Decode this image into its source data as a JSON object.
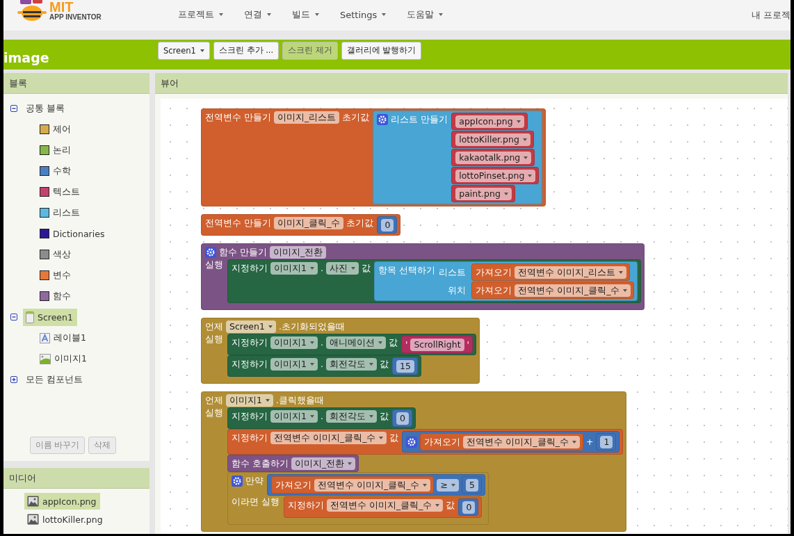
{
  "logo": {
    "title": "MIT",
    "subtitle": "APP INVENTOR"
  },
  "menu": [
    {
      "label": "프로젝트"
    },
    {
      "label": "연결"
    },
    {
      "label": "빌드"
    },
    {
      "label": "Settings"
    },
    {
      "label": "도움말"
    }
  ],
  "menu_right": "내 프로젝",
  "project": {
    "title": "image",
    "buttons": [
      {
        "label": "Screen1",
        "kind": "dropdown",
        "disabled": false
      },
      {
        "label": "스크린 추가 ...",
        "kind": "button",
        "disabled": false
      },
      {
        "label": "스크린 제거",
        "kind": "button",
        "disabled": true
      },
      {
        "label": "갤러리에 발행하기",
        "kind": "button",
        "disabled": false
      }
    ]
  },
  "blocks_panel": {
    "title": "블록",
    "tree": [
      {
        "label": "공통 블록",
        "kind": "group",
        "expanded": true,
        "selected": false,
        "children": [
          {
            "label": "제어",
            "kind": "category",
            "color": "#d6ab4a",
            "selected": false
          },
          {
            "label": "논리",
            "kind": "category",
            "color": "#86b64c",
            "selected": false
          },
          {
            "label": "수학",
            "kind": "category",
            "color": "#4a80c2",
            "selected": false
          },
          {
            "label": "텍스트",
            "kind": "category",
            "color": "#c4426f",
            "selected": false
          },
          {
            "label": "리스트",
            "kind": "category",
            "color": "#5cb8e0",
            "selected": false
          },
          {
            "label": "Dictionaries",
            "kind": "category",
            "color": "#2d1898",
            "selected": false
          },
          {
            "label": "색상",
            "kind": "category",
            "color": "#8c8c8c",
            "selected": false
          },
          {
            "label": "변수",
            "kind": "category",
            "color": "#e5783a",
            "selected": false
          },
          {
            "label": "함수",
            "kind": "category",
            "color": "#8f6a9f",
            "selected": false
          }
        ]
      },
      {
        "label": "Screen1",
        "kind": "screen",
        "expanded": true,
        "selected": true,
        "children": [
          {
            "label": "레이블1",
            "kind": "label",
            "selected": false
          },
          {
            "label": "이미지1",
            "kind": "image",
            "selected": false
          }
        ]
      },
      {
        "label": "모든 컴포넌트",
        "kind": "group",
        "expanded": false,
        "selected": false
      }
    ],
    "buttons": [
      {
        "label": "이름 바꾸기",
        "disabled": true
      },
      {
        "label": "삭제",
        "disabled": true
      }
    ]
  },
  "media_panel": {
    "title": "미디어",
    "items": [
      {
        "label": "appIcon.png",
        "selected": true
      },
      {
        "label": "lottoKiller.png",
        "selected": false
      }
    ]
  },
  "viewer": {
    "title": "뷰어",
    "stacks": [
      {
        "color": "#d05f2d",
        "head": [
          {
            "kind": "text",
            "text": "전역변수 만들기"
          },
          {
            "kind": "field",
            "text": "이미지_리스트"
          },
          {
            "kind": "text",
            "text": "초기값"
          }
        ],
        "inputs": [
          {
            "block": {
              "color": "#49a5d3",
              "head": [
                {
                  "kind": "gear"
                },
                {
                  "kind": "text",
                  "text": "리스트 만들기"
                }
              ],
              "inputs": [
                {
                  "block": {
                    "color": "#c13b44",
                    "head": [
                      {
                        "kind": "dropdown",
                        "text": "appIcon.png"
                      }
                    ]
                  }
                },
                {
                  "block": {
                    "color": "#c13b44",
                    "head": [
                      {
                        "kind": "dropdown",
                        "text": "lottoKiller.png"
                      }
                    ]
                  }
                },
                {
                  "block": {
                    "color": "#c13b44",
                    "head": [
                      {
                        "kind": "dropdown",
                        "text": "kakaotalk.png"
                      }
                    ]
                  }
                },
                {
                  "block": {
                    "color": "#c13b44",
                    "head": [
                      {
                        "kind": "dropdown",
                        "text": "lottoPinset.png"
                      }
                    ]
                  }
                },
                {
                  "block": {
                    "color": "#c13b44",
                    "head": [
                      {
                        "kind": "dropdown",
                        "text": "paint.png"
                      }
                    ]
                  }
                }
              ]
            }
          }
        ]
      },
      {
        "color": "#d05f2d",
        "head": [
          {
            "kind": "text",
            "text": "전역변수 만들기"
          },
          {
            "kind": "field",
            "text": "이미지_클릭_수"
          },
          {
            "kind": "text",
            "text": "초기값"
          }
        ],
        "inputs": [
          {
            "block": {
              "color": "#3f71b5",
              "head": [
                {
                  "kind": "field",
                  "text": "0"
                }
              ]
            }
          }
        ]
      },
      {
        "color": "#7c5385",
        "head": [
          {
            "kind": "gear"
          },
          {
            "kind": "text",
            "text": "함수 만들기"
          },
          {
            "kind": "field",
            "text": "이미지_전환"
          }
        ],
        "statements": [
          {
            "label": "실행",
            "blocks": [
              {
                "color": "#266643",
                "head": [
                  {
                    "kind": "text",
                    "text": "지정하기"
                  },
                  {
                    "kind": "dropdown",
                    "text": "이미지1"
                  },
                  {
                    "kind": "text",
                    "text": "."
                  },
                  {
                    "kind": "dropdown",
                    "text": "사진"
                  },
                  {
                    "kind": "text",
                    "text": "값"
                  }
                ],
                "inputs": [
                  {
                    "block": {
                      "color": "#49a5d3",
                      "head": [
                        {
                          "kind": "text",
                          "text": "항목 선택하기"
                        }
                      ],
                      "inputs": [
                        {
                          "label": "리스트",
                          "block": {
                            "color": "#d05f2d",
                            "head": [
                              {
                                "kind": "text",
                                "text": "가져오기"
                              },
                              {
                                "kind": "dropdown",
                                "text": "전역변수 이미지_리스트"
                              }
                            ]
                          }
                        },
                        {
                          "label": "위치",
                          "block": {
                            "color": "#d05f2d",
                            "head": [
                              {
                                "kind": "text",
                                "text": "가져오기"
                              },
                              {
                                "kind": "dropdown",
                                "text": "전역변수 이미지_클릭_수"
                              }
                            ]
                          }
                        }
                      ]
                    }
                  }
                ]
              }
            ]
          }
        ]
      },
      {
        "color": "#b18e35",
        "head": [
          {
            "kind": "text",
            "text": "언제"
          },
          {
            "kind": "dropdown",
            "text": "Screen1"
          },
          {
            "kind": "text",
            "text": ".초기화되었을때"
          }
        ],
        "statements": [
          {
            "label": "실행",
            "blocks": [
              {
                "color": "#266643",
                "head": [
                  {
                    "kind": "text",
                    "text": "지정하기"
                  },
                  {
                    "kind": "dropdown",
                    "text": "이미지1"
                  },
                  {
                    "kind": "text",
                    "text": "."
                  },
                  {
                    "kind": "dropdown",
                    "text": "애니메이션"
                  },
                  {
                    "kind": "text",
                    "text": "값"
                  }
                ],
                "inputs": [
                  {
                    "block": {
                      "color": "#b32d5e",
                      "head": [
                        {
                          "kind": "text",
                          "text": "'"
                        },
                        {
                          "kind": "field",
                          "text": "ScrollRight"
                        },
                        {
                          "kind": "text",
                          "text": "'"
                        }
                      ]
                    }
                  }
                ]
              },
              {
                "color": "#266643",
                "head": [
                  {
                    "kind": "text",
                    "text": "지정하기"
                  },
                  {
                    "kind": "dropdown",
                    "text": "이미지1"
                  },
                  {
                    "kind": "text",
                    "text": "."
                  },
                  {
                    "kind": "dropdown",
                    "text": "회전각도"
                  },
                  {
                    "kind": "text",
                    "text": "값"
                  }
                ],
                "inputs": [
                  {
                    "block": {
                      "color": "#3f71b5",
                      "head": [
                        {
                          "kind": "field",
                          "text": "15"
                        }
                      ]
                    }
                  }
                ]
              }
            ]
          }
        ]
      },
      {
        "color": "#b18e35",
        "head": [
          {
            "kind": "text",
            "text": "언제"
          },
          {
            "kind": "dropdown",
            "text": "이미지1"
          },
          {
            "kind": "text",
            "text": ".클릭했을때"
          }
        ],
        "statements": [
          {
            "label": "실행",
            "blocks": [
              {
                "color": "#266643",
                "head": [
                  {
                    "kind": "text",
                    "text": "지정하기"
                  },
                  {
                    "kind": "dropdown",
                    "text": "이미지1"
                  },
                  {
                    "kind": "text",
                    "text": "."
                  },
                  {
                    "kind": "dropdown",
                    "text": "회전각도"
                  },
                  {
                    "kind": "text",
                    "text": "값"
                  }
                ],
                "inputs": [
                  {
                    "block": {
                      "color": "#3f71b5",
                      "head": [
                        {
                          "kind": "field",
                          "text": "0"
                        }
                      ]
                    }
                  }
                ]
              },
              {
                "color": "#d05f2d",
                "head": [
                  {
                    "kind": "text",
                    "text": "지정하기"
                  },
                  {
                    "kind": "dropdown",
                    "text": "전역변수 이미지_클릭_수"
                  },
                  {
                    "kind": "text",
                    "text": "값"
                  }
                ],
                "inputs": [
                  {
                    "block": {
                      "color": "#3f71b5",
                      "head": [
                        {
                          "kind": "gear"
                        },
                        {
                          "kind": "block",
                          "block": {
                            "color": "#d05f2d",
                            "head": [
                              {
                                "kind": "text",
                                "text": "가져오기"
                              },
                              {
                                "kind": "dropdown",
                                "text": "전역변수 이미지_클릭_수"
                              }
                            ]
                          }
                        },
                        {
                          "kind": "text",
                          "text": "+"
                        },
                        {
                          "kind": "block",
                          "block": {
                            "color": "#3f71b5",
                            "head": [
                              {
                                "kind": "field",
                                "text": "1"
                              }
                            ]
                          }
                        }
                      ]
                    }
                  }
                ]
              },
              {
                "color": "#7c5385",
                "head": [
                  {
                    "kind": "text",
                    "text": "함수 호출하기"
                  },
                  {
                    "kind": "dropdown",
                    "text": "이미지_전환"
                  }
                ]
              },
              {
                "color": "#b18e35",
                "head": [
                  {
                    "kind": "gear"
                  },
                  {
                    "kind": "text",
                    "text": "만약"
                  }
                ],
                "inputs": [
                  {
                    "block": {
                      "color": "#3f71b5",
                      "head": [
                        {
                          "kind": "block",
                          "block": {
                            "color": "#d05f2d",
                            "head": [
                              {
                                "kind": "text",
                                "text": "가져오기"
                              },
                              {
                                "kind": "dropdown",
                                "text": "전역변수 이미지_클릭_수"
                              }
                            ]
                          }
                        },
                        {
                          "kind": "dropdown",
                          "text": "≥"
                        },
                        {
                          "kind": "block",
                          "block": {
                            "color": "#3f71b5",
                            "head": [
                              {
                                "kind": "field",
                                "text": "5"
                              }
                            ]
                          }
                        }
                      ]
                    }
                  }
                ],
                "statements": [
                  {
                    "label": "이라면 실행",
                    "blocks": [
                      {
                        "color": "#d05f2d",
                        "head": [
                          {
                            "kind": "text",
                            "text": "지정하기"
                          },
                          {
                            "kind": "dropdown",
                            "text": "전역변수 이미지_클릭_수"
                          },
                          {
                            "kind": "text",
                            "text": "값"
                          }
                        ],
                        "inputs": [
                          {
                            "block": {
                              "color": "#3f71b5",
                              "head": [
                                {
                                  "kind": "field",
                                  "text": "0"
                                }
                              ]
                            }
                          }
                        ]
                      }
                    ]
                  }
                ]
              }
            ]
          }
        ]
      }
    ]
  }
}
